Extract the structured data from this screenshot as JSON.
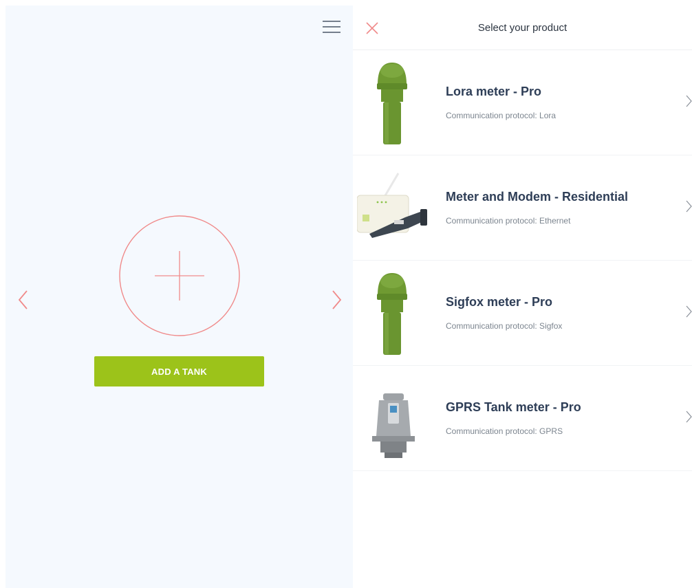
{
  "left_panel": {
    "add_button_label": "ADD A TANK"
  },
  "right_panel": {
    "title": "Select your product",
    "products": [
      {
        "name": "Lora meter - Pro",
        "protocol": "Communication protocol: Lora",
        "image": "green-dome-meter-image"
      },
      {
        "name": "Meter and Modem - Residential",
        "protocol": "Communication protocol: Ethernet",
        "image": "modem-and-meter-image"
      },
      {
        "name": "Sigfox meter - Pro",
        "protocol": "Communication protocol: Sigfox",
        "image": "green-dome-meter-image"
      },
      {
        "name": "GPRS Tank meter - Pro",
        "protocol": "Communication protocol: GPRS",
        "image": "grey-tank-meter-image"
      }
    ]
  },
  "icons": {
    "menu": "hamburger-menu-icon",
    "prev": "chevron-left-icon",
    "next": "chevron-right-icon",
    "add": "plus-circle-icon",
    "close": "close-icon",
    "row_arrow": "chevron-right-icon"
  },
  "colors": {
    "accent_red": "#f08a8a",
    "button_green": "#9cc31a",
    "meter_green": "#6f9a32",
    "panel_bg": "#f5f9fe",
    "title_text": "#2e3e57",
    "muted_text": "#7c858f",
    "menu_icon": "#4a5566"
  }
}
